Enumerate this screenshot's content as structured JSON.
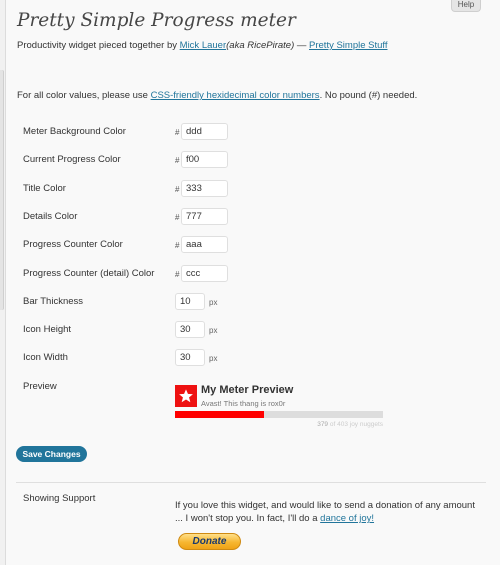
{
  "help_tab": "Help",
  "page": {
    "title": "Pretty Simple Progress meter",
    "subtitle_prefix": "Productivity widget pieced together by ",
    "author_link": "Mick Lauer",
    "author_alias": "(aka RicePirate)",
    "subtitle_sep": " — ",
    "site_link": "Pretty Simple Stuff"
  },
  "intro": {
    "prefix": "For all color values, please use ",
    "link": "CSS-friendly hexidecimal color numbers",
    "suffix": ". No pound (#) needed."
  },
  "form": {
    "hash": "#",
    "unit": "px",
    "meter_bg": {
      "label": "Meter Background Color",
      "value": "ddd"
    },
    "current_progress": {
      "label": "Current Progress Color",
      "value": "f00"
    },
    "title_color": {
      "label": "Title Color",
      "value": "333"
    },
    "details_color": {
      "label": "Details Color",
      "value": "777"
    },
    "counter_color": {
      "label": "Progress Counter Color",
      "value": "aaa"
    },
    "counter_detail_color": {
      "label": "Progress Counter (detail) Color",
      "value": "ccc"
    },
    "bar_thickness": {
      "label": "Bar Thickness",
      "value": "10"
    },
    "icon_height": {
      "label": "Icon Height",
      "value": "30"
    },
    "icon_width": {
      "label": "Icon Width",
      "value": "30"
    }
  },
  "preview": {
    "label": "Preview",
    "title": "My Meter Preview",
    "details": "Avast! This thang is rox0r",
    "counter_num": "379",
    "counter_rest": "of 403 joy nuggets",
    "progress_fraction": 0.43,
    "colors": {
      "icon": "#ee1111",
      "fill": "#ff0000",
      "track": "#dddddd"
    }
  },
  "save_button": "Save Changes",
  "support": {
    "label": "Showing Support",
    "text": "If you love this widget, and would like to send a donation of any amount ... I won't stop you. In fact, I'll do a ",
    "link": "dance of joy!",
    "donate_button": "Donate"
  },
  "colors": {
    "accent": "#21759b",
    "link": "#21759b"
  }
}
